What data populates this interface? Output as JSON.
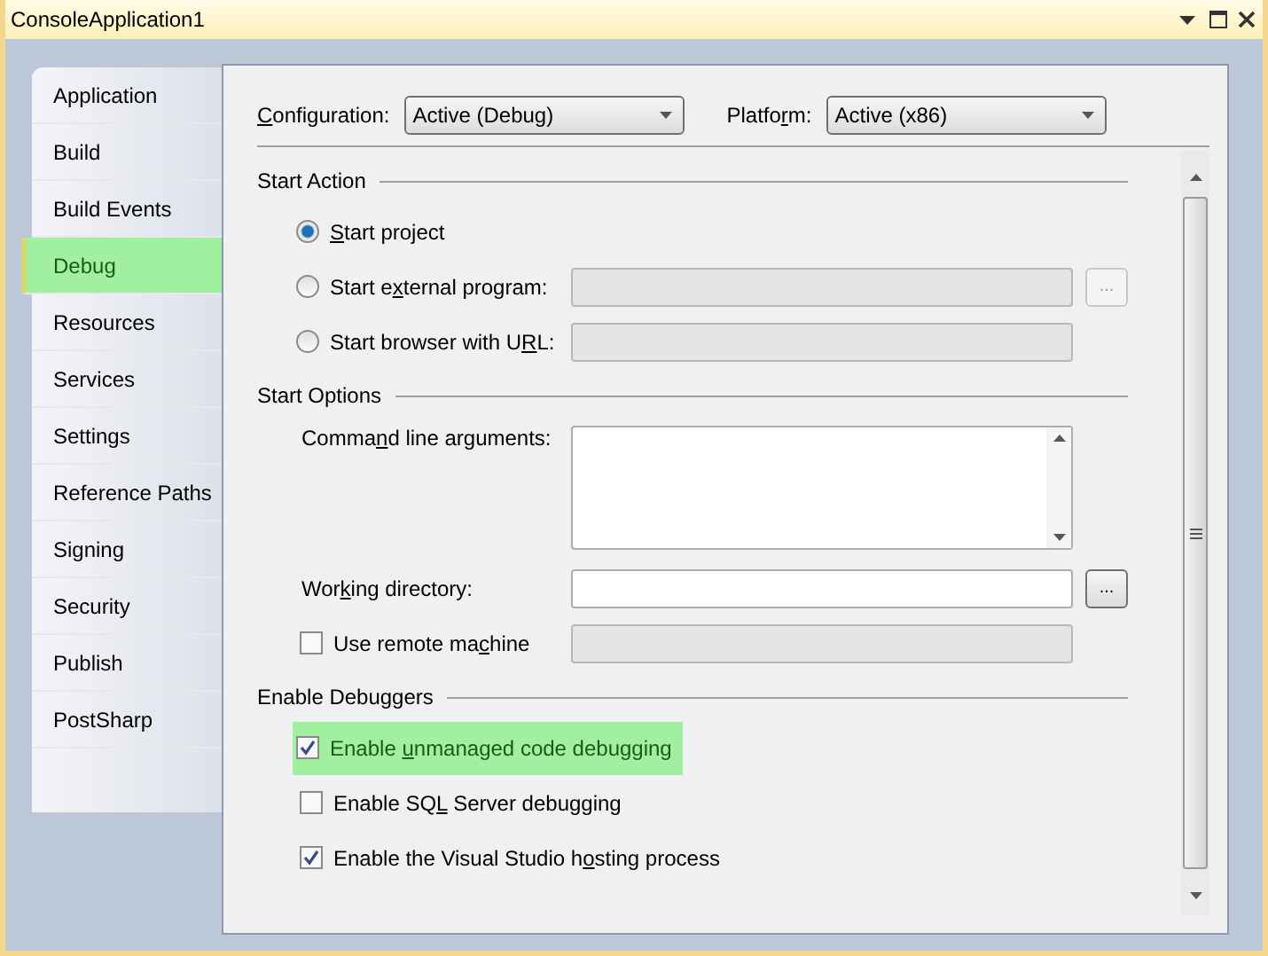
{
  "window": {
    "title": "ConsoleApplication1"
  },
  "sidebar": {
    "items": [
      {
        "label": "Application",
        "selected": false,
        "highlighted": false
      },
      {
        "label": "Build",
        "selected": false,
        "highlighted": false
      },
      {
        "label": "Build Events",
        "selected": false,
        "highlighted": false
      },
      {
        "label": "Debug",
        "selected": true,
        "highlighted": true
      },
      {
        "label": "Resources",
        "selected": false,
        "highlighted": false
      },
      {
        "label": "Services",
        "selected": false,
        "highlighted": false
      },
      {
        "label": "Settings",
        "selected": false,
        "highlighted": false
      },
      {
        "label": "Reference Paths",
        "selected": false,
        "highlighted": false
      },
      {
        "label": "Signing",
        "selected": false,
        "highlighted": false
      },
      {
        "label": "Security",
        "selected": false,
        "highlighted": false
      },
      {
        "label": "Publish",
        "selected": false,
        "highlighted": false
      },
      {
        "label": "PostSharp",
        "selected": false,
        "highlighted": false
      }
    ]
  },
  "header": {
    "selectors": [
      {
        "key": "C",
        "post": "onfiguration:",
        "value": "Active (Debug)"
      },
      {
        "pre": "Platfo",
        "key": "r",
        "post": "m:",
        "value": "Active (x86)"
      }
    ]
  },
  "sections": [
    {
      "title": "Start Action",
      "rows": [
        {
          "kind": "radio",
          "key": "S",
          "post": "tart project",
          "selected": true
        },
        {
          "kind": "radio",
          "pre": "Start e",
          "key": "x",
          "post": "ternal program:",
          "selected": false,
          "field": {
            "disabled": true
          },
          "browse": {
            "label": "...",
            "disabled": true
          }
        },
        {
          "kind": "radio",
          "pre": "Start browser with U",
          "key": "R",
          "post": "L:",
          "selected": false,
          "field": {
            "disabled": true
          }
        }
      ]
    },
    {
      "title": "Start Options",
      "rows": [
        {
          "kind": "textarea",
          "pre": "Comma",
          "key": "n",
          "post": "d line arguments:",
          "field": {
            "disabled": false
          }
        },
        {
          "kind": "field",
          "pre": "Wor",
          "key": "k",
          "post": "ing directory:",
          "field": {
            "disabled": false
          },
          "browse": {
            "label": "...",
            "disabled": false
          }
        },
        {
          "kind": "checkbox",
          "pre": "Use remote ma",
          "key": "c",
          "post": "hine",
          "checked": false,
          "highlighted": false,
          "field": {
            "disabled": true
          }
        }
      ]
    },
    {
      "title": "Enable Debuggers",
      "rows": [
        {
          "kind": "checkbox",
          "pre": "Enable ",
          "key": "u",
          "post": "nmanaged code debugging",
          "checked": true,
          "highlighted": true
        },
        {
          "kind": "checkbox",
          "pre": "Enable SQ",
          "key": "L",
          "post": " Server debugging",
          "checked": false,
          "highlighted": false
        },
        {
          "kind": "checkbox",
          "pre": "Enable the Visual Studio h",
          "key": "o",
          "post": "sting process",
          "checked": true,
          "highlighted": false
        }
      ]
    }
  ]
}
